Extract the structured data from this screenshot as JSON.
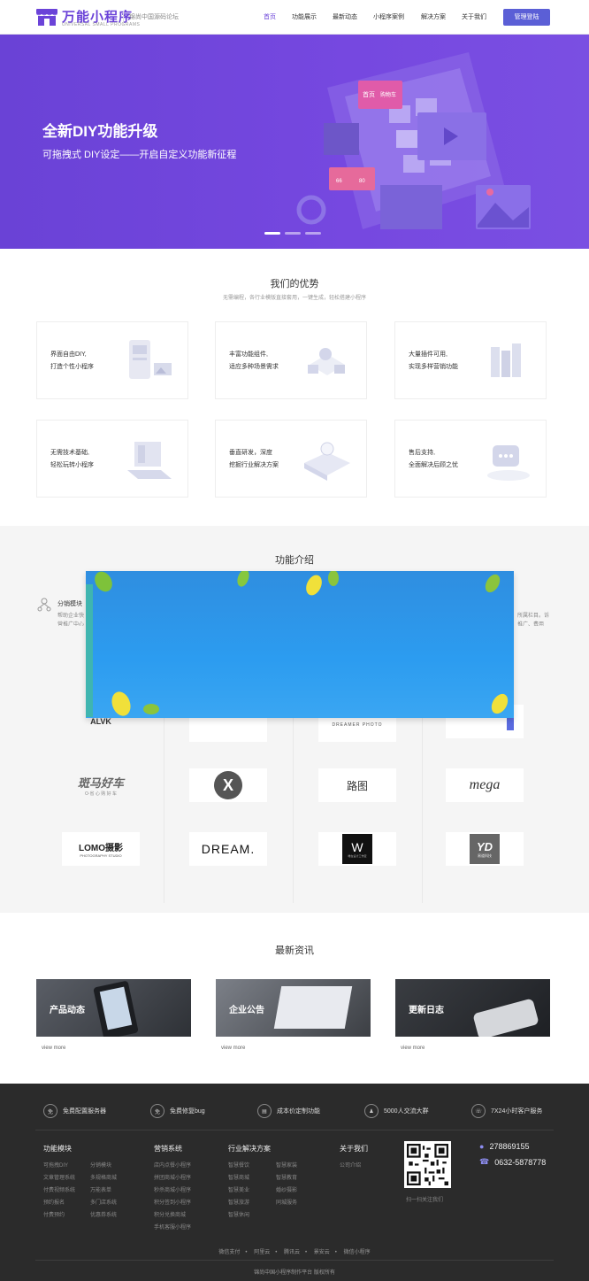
{
  "header": {
    "brand": "万能小程序",
    "brand_sub": "UNIVERSAL SMALL PROGRAMS",
    "tagline": "锦尚中国源码论坛",
    "nav": [
      "首页",
      "功能展示",
      "最新动态",
      "小程序案例",
      "解决方案",
      "关于我们"
    ],
    "login": "管理登陆"
  },
  "hero": {
    "title": "全新DIY功能升级",
    "subtitle": "可拖拽式 DIY设定——开启自定义功能新征程",
    "slide_count": 3,
    "active_slide": 1,
    "art_label_home": "首页",
    "art_label_shop": "购物车",
    "art_like_count": "66",
    "art_msg_count": "80"
  },
  "advantages": {
    "title": "我们的优势",
    "subtitle": "无需编程，各行业模版直接套用，一键生成，轻松搭建小程序",
    "cards": [
      {
        "line1": "界面自由DIY,",
        "line2": "打造个性小程序"
      },
      {
        "line1": "丰富功能组件,",
        "line2": "适应多种场景需求"
      },
      {
        "line1": "大量插件可用,",
        "line2": "实现多样营销功能"
      },
      {
        "line1": "无需技术基础,",
        "line2": "轻松玩转小程序"
      },
      {
        "line1": "垂直研发，深度",
        "line2": "挖掘行业解决方案"
      },
      {
        "line1": "售后支持,",
        "line2": "全面解决后顾之忧"
      }
    ]
  },
  "features": {
    "title": "功能介绍",
    "item_title": "分销模块",
    "item_desc": "帮助企业快",
    "item_desc2": "营推广中心",
    "right_desc": "所属栏目。诉",
    "right_desc2": "推广、费用"
  },
  "partners": {
    "logos": [
      "ALVK",
      "",
      "DREAMER PHOTO",
      "",
      "斑马好车",
      "X",
      "路图",
      "mega",
      "LOMO摄影",
      "DREAM.",
      "W",
      "YD"
    ],
    "zebra_sub": "O·省 心  购 好 车",
    "lomo_sub": "PHOTOGRAPHY STUDIO",
    "mega_sub": "mega",
    "yd_sub": "易道科技",
    "w_sub": "唯在设计工作室"
  },
  "news": {
    "title": "最新资讯",
    "items": [
      {
        "label": "产品动态",
        "more": "view more"
      },
      {
        "label": "企业公告",
        "more": "view more"
      },
      {
        "label": "更新日志",
        "more": "view more"
      }
    ]
  },
  "footer": {
    "badges": [
      {
        "icon": "免",
        "text": "免费配置服务器"
      },
      {
        "icon": "免",
        "text": "免费修复bug"
      },
      {
        "icon": "▤",
        "text": "成本价定制功能"
      },
      {
        "icon": "♟",
        "text": "5000人交流大群"
      },
      {
        "icon": "☏",
        "text": "7X24小时客户服务"
      }
    ],
    "columns": [
      {
        "title": "功能模块",
        "links": [
          "可拖拽DIY",
          "分销模块",
          "文章管理系统",
          "多规格商城",
          "付费视频系统",
          "万能表单",
          "预约报名",
          "多门店系统",
          "付费预约",
          "优惠券系统"
        ]
      },
      {
        "title": "营销系统",
        "links": [
          "店内点餐小程序",
          "拼团商城小程序",
          "秒杀商城小程序",
          "积分签到小程序",
          "积分兑换商城",
          "手机客服小程序"
        ]
      },
      {
        "title": "行业解决方案",
        "links": [
          "智慧餐饮",
          "智慧家装",
          "智慧商城",
          "智慧教育",
          "智慧美业",
          "婚纱摄影",
          "智慧旅游",
          "同城服务",
          "智慧休闲"
        ]
      },
      {
        "title": "关于我们",
        "links": [
          "公司介绍"
        ]
      }
    ],
    "qr_caption": "扫一扫关注我们",
    "qq": "278869155",
    "phone": "0632-5878778",
    "bottom_links": [
      "微信支付",
      "阿里云",
      "腾讯云",
      "景安云",
      "微信小程序"
    ],
    "copyright": "锦尚中国小程序制作平台  版权所有"
  },
  "colors": {
    "accent": "#6b43d8",
    "button": "#5b5fd6",
    "hero": "#7046dc",
    "footer": "#2b2b2b"
  }
}
